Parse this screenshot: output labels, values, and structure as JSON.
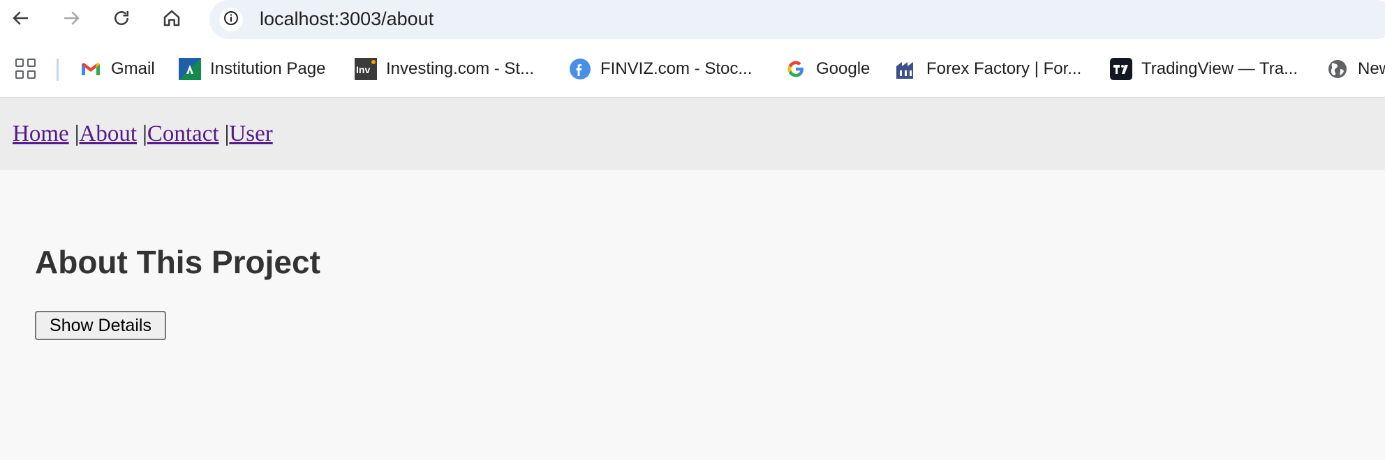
{
  "browser": {
    "url": "localhost:3003/about",
    "icons": {
      "back": "arrow-left-icon",
      "forward": "arrow-right-icon",
      "reload": "reload-icon",
      "home": "home-icon",
      "site_info": "info-icon",
      "apps": "apps-grid-icon"
    },
    "bookmarks": [
      {
        "label": "Gmail",
        "icon": "gmail-icon"
      },
      {
        "label": "Institution Page",
        "icon": "institution-icon"
      },
      {
        "label": "Investing.com - St...",
        "icon": "investing-icon"
      },
      {
        "label": "FINVIZ.com - Stoc...",
        "icon": "finviz-icon"
      },
      {
        "label": "Google",
        "icon": "google-icon"
      },
      {
        "label": "Forex Factory | For...",
        "icon": "forex-factory-icon"
      },
      {
        "label": "TradingView — Tra...",
        "icon": "tradingview-icon"
      },
      {
        "label": "New",
        "icon": "globe-icon"
      }
    ]
  },
  "page": {
    "nav": {
      "home": "Home",
      "about": "About",
      "contact": "Contact",
      "user": "User",
      "separator": "|"
    },
    "title": "About This Project",
    "details_button": "Show Details"
  },
  "colors": {
    "link": "#551a8b",
    "nav_background": "#ececec",
    "page_background": "#f8f8f8",
    "title": "#333333",
    "omnibox": "#edf1f8"
  }
}
